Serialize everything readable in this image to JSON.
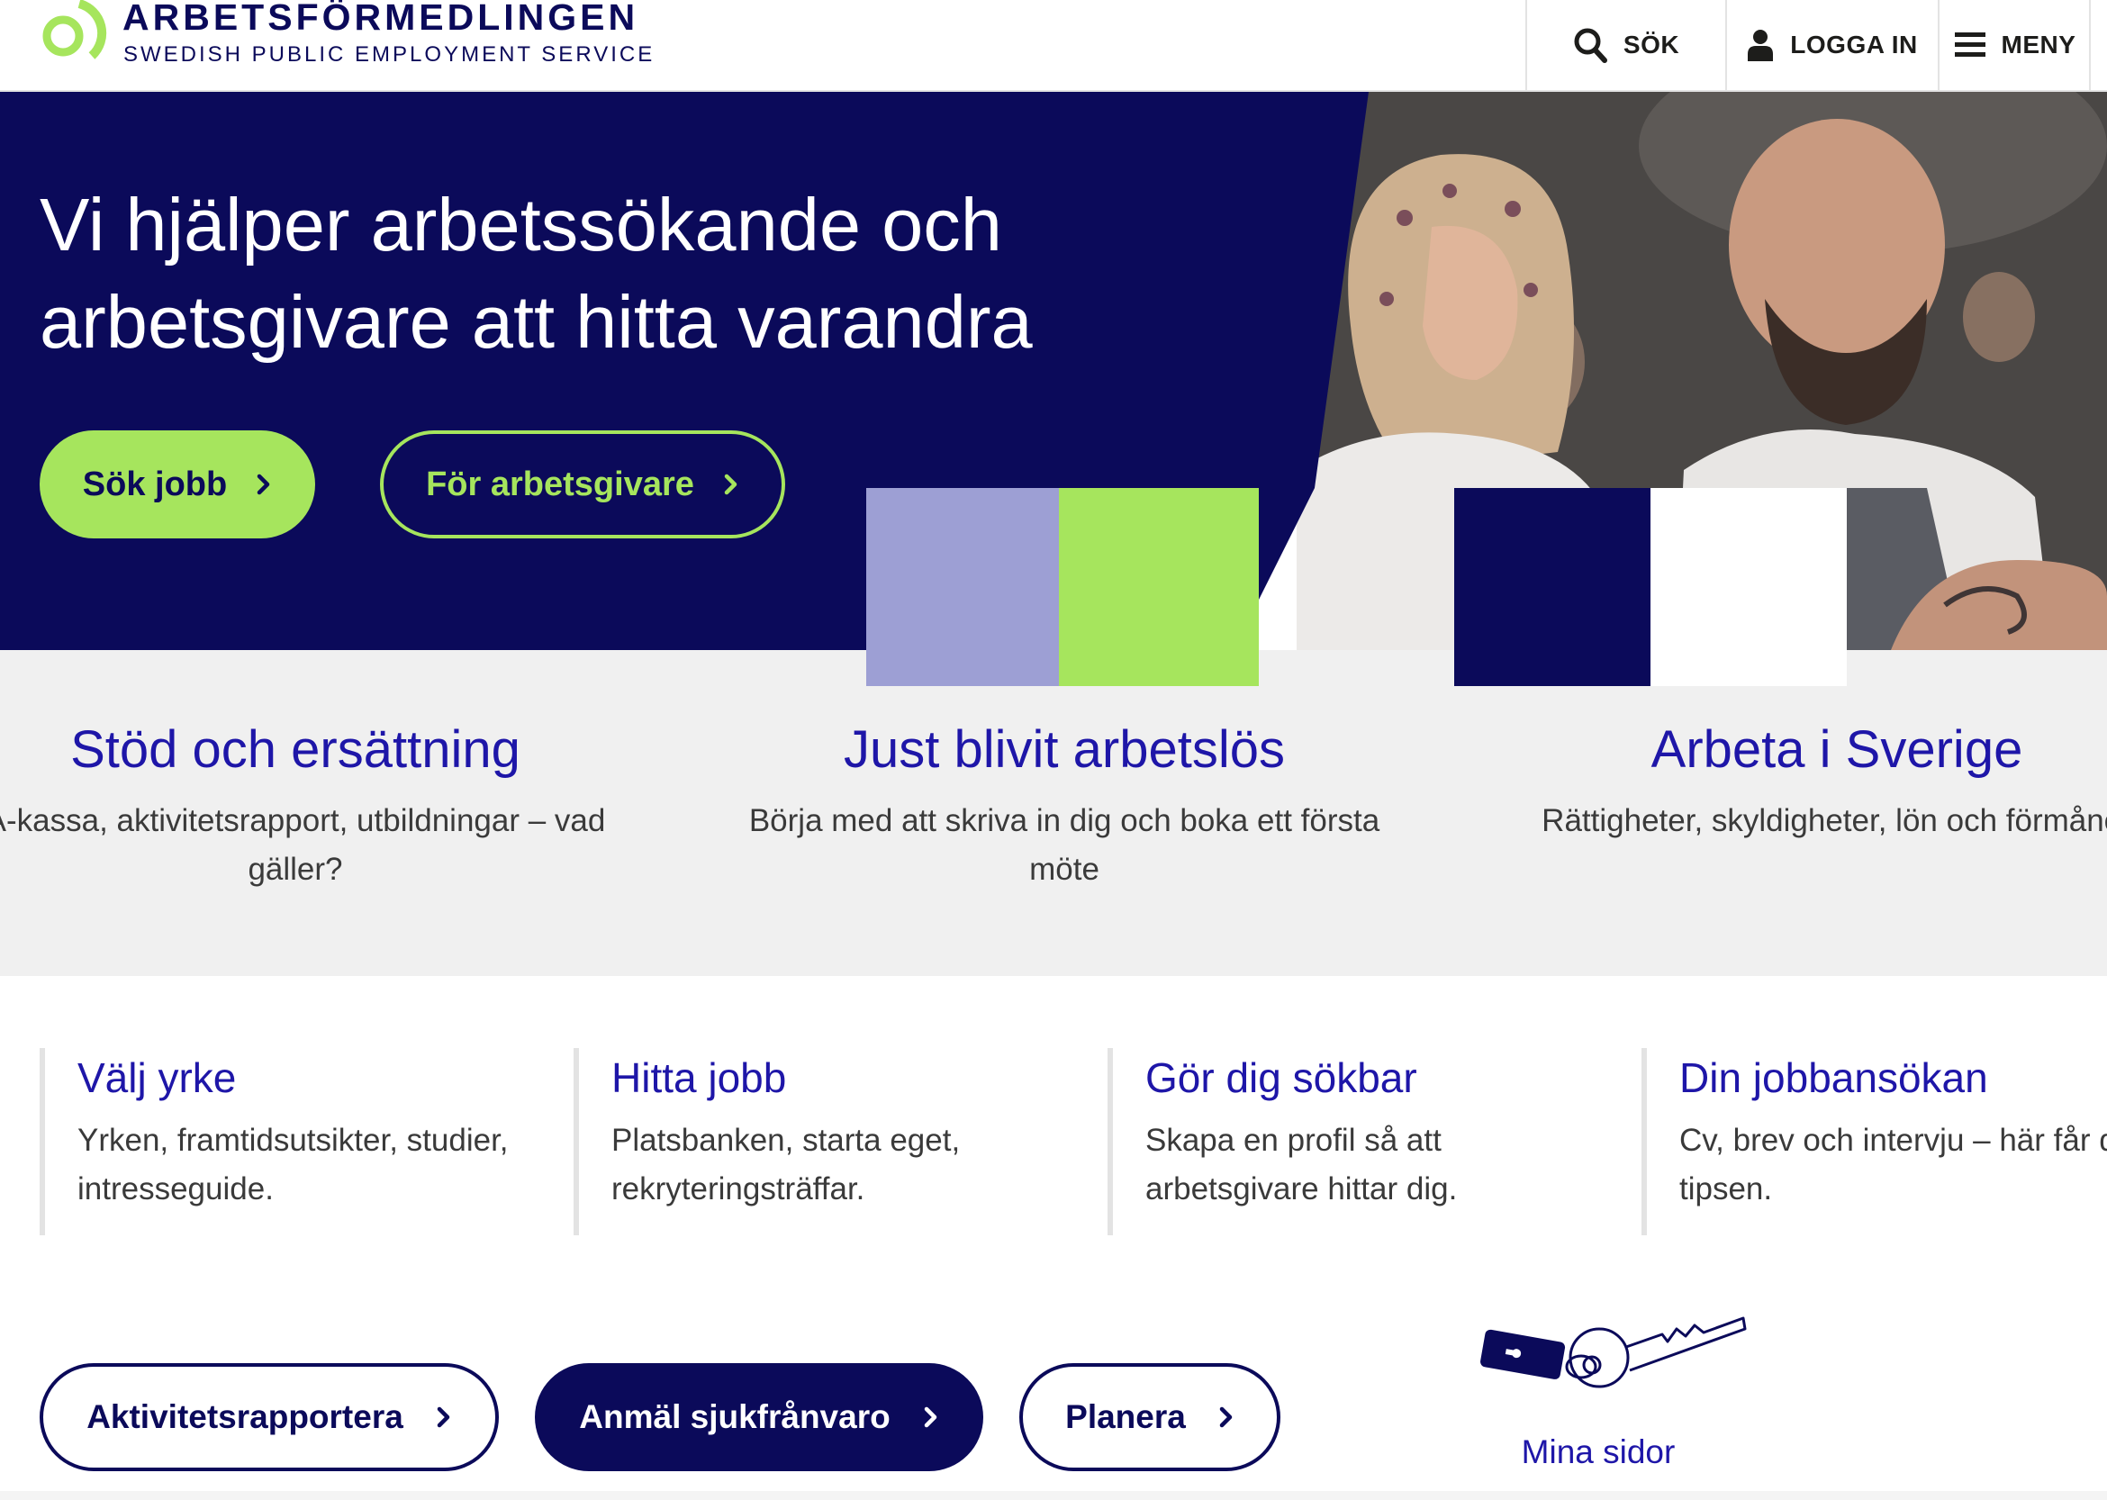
{
  "header": {
    "logo_title": "ARBETSFÖRMEDLINGEN",
    "logo_subtitle": "SWEDISH PUBLIC EMPLOYMENT SERVICE",
    "search_label": "SÖK",
    "login_label": "LOGGA IN",
    "menu_label": "MENY"
  },
  "hero": {
    "title": "Vi hjälper arbetssökande och arbetsgivare att hitta varandra",
    "primary_button": "Sök jobb",
    "secondary_button": "För arbetsgivare"
  },
  "features": [
    {
      "title": "Stöd och ersättning",
      "text": "A-kassa, aktivitetsrapport, utbildningar – vad gäller?"
    },
    {
      "title": "Just blivit arbetslös",
      "text": "Börja med att skriva in dig och boka ett första möte"
    },
    {
      "title": "Arbeta i Sverige",
      "text": "Rättigheter, skyldigheter, lön och förmåner"
    }
  ],
  "cards": [
    {
      "title": "Välj yrke",
      "text": "Yrken, framtidsutsikter, studier, intresseguide."
    },
    {
      "title": "Hitta jobb",
      "text": "Platsbanken, starta eget, rekryteringsträffar."
    },
    {
      "title": "Gör dig sökbar",
      "text": "Skapa en profil så att arbetsgivare hittar dig."
    },
    {
      "title": "Din jobbansökan",
      "text": "Cv, brev och intervju – här får du tipsen."
    }
  ],
  "actions": {
    "aktivitet": "Aktivitetsrapportera",
    "sjuk": "Anmäl sjukfrånvaro",
    "planera": "Planera"
  },
  "mina_sidor": "Mina sidor",
  "icons": {
    "logo": "logo-mark-icon",
    "search": "search-icon",
    "login": "user-icon",
    "menu": "hamburger-icon",
    "chevron": "chevron-right-icon",
    "key": "key-icon"
  },
  "colors": {
    "navy": "#0b0a5a",
    "green": "#a6e55d",
    "lilac": "#9d9fd4",
    "link_blue": "#1e16a8",
    "grey_band": "#f0f0f0"
  }
}
